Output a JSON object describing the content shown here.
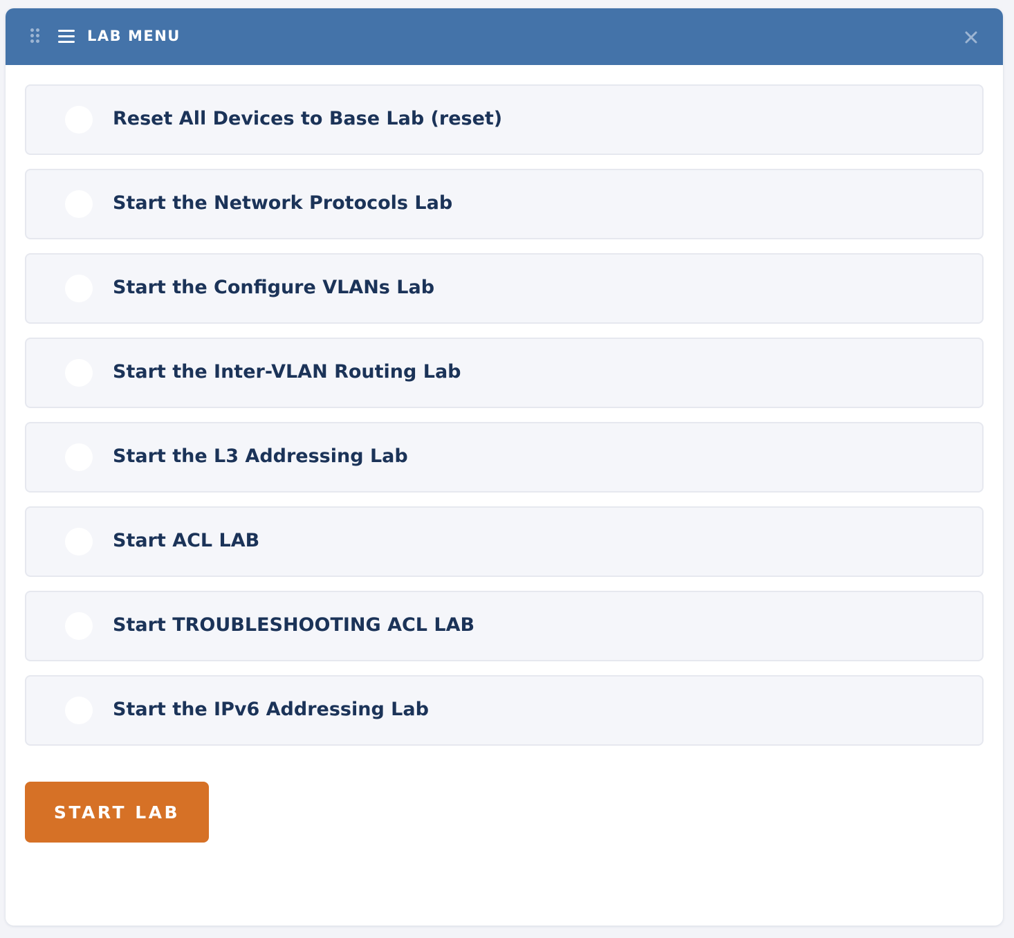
{
  "header": {
    "title": "LAB MENU",
    "icons": [
      "drag-handle-icon",
      "hamburger-menu-icon",
      "close-icon"
    ]
  },
  "options": [
    {
      "label": "Reset All Devices to Base Lab (reset)",
      "selected": false
    },
    {
      "label": "Start the Network Protocols Lab",
      "selected": false
    },
    {
      "label": "Start the Configure VLANs Lab",
      "selected": false
    },
    {
      "label": "Start the Inter-VLAN Routing Lab",
      "selected": false
    },
    {
      "label": "Start the L3 Addressing Lab",
      "selected": false
    },
    {
      "label": "Start ACL LAB",
      "selected": false
    },
    {
      "label": "Start TROUBLESHOOTING ACL LAB",
      "selected": false
    },
    {
      "label": "Start the IPv6 Addressing Lab",
      "selected": false
    }
  ],
  "actions": {
    "start_label": "START LAB"
  },
  "colors": {
    "header_bg": "#4473a9",
    "accent": "#d67126",
    "text": "#1b3358"
  }
}
